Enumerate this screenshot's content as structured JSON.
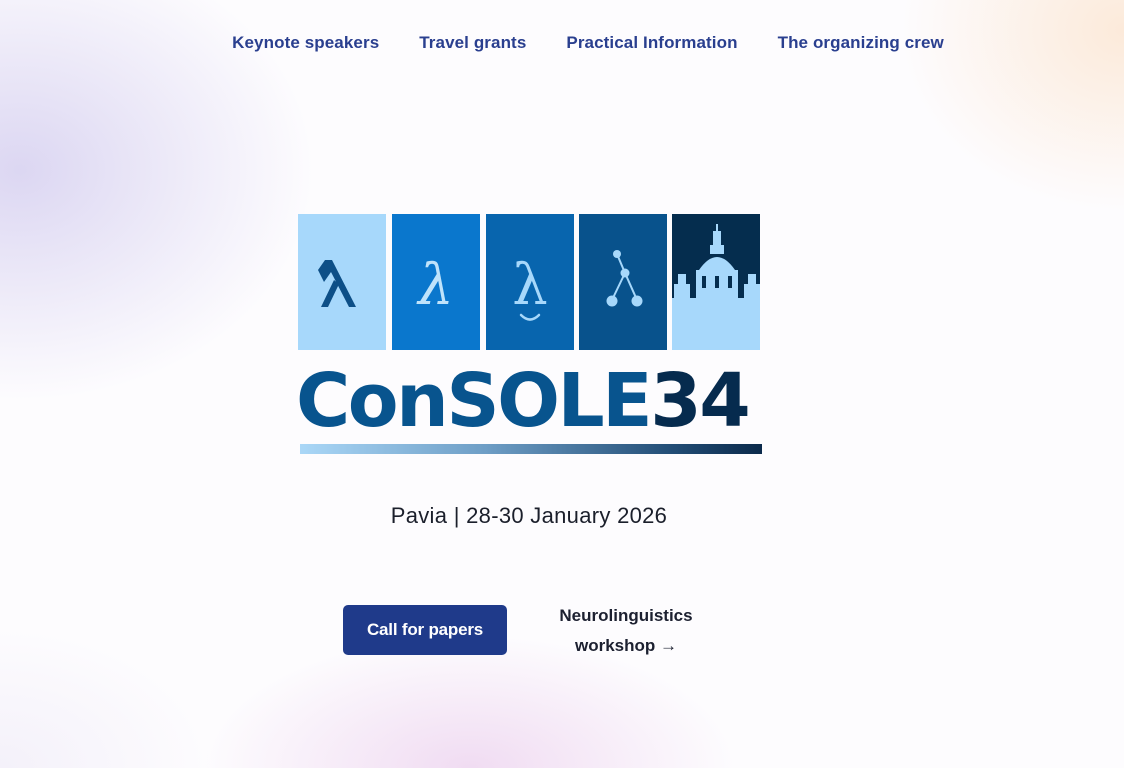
{
  "nav": {
    "items": [
      {
        "label": "Keynote speakers"
      },
      {
        "label": "Travel grants"
      },
      {
        "label": "Practical Information"
      },
      {
        "label": "The organizing crew"
      }
    ]
  },
  "logo": {
    "wordmark_part1": "ConSOLE",
    "wordmark_part2": "34",
    "tile_icons": [
      "lambda-icon",
      "lambda-serif-icon",
      "lambda-smile-icon",
      "lambda-tree-icon",
      "pavia-dome-icon"
    ]
  },
  "hero": {
    "location_dates": "Pavia | 28-30 January 2026"
  },
  "actions": {
    "call_for_papers": "Call for papers",
    "workshop_line1": "Neurolinguistics",
    "workshop_line2": "workshop →"
  },
  "colors": {
    "nav_link": "#2a3f8f",
    "primary_button": "#1f3a8a",
    "tile_light": "#a7d8fb",
    "tile_blue": "#0a77cd",
    "tile_mid": "#0865ae",
    "tile_deep": "#08528c",
    "tile_navy": "#052d4e"
  }
}
